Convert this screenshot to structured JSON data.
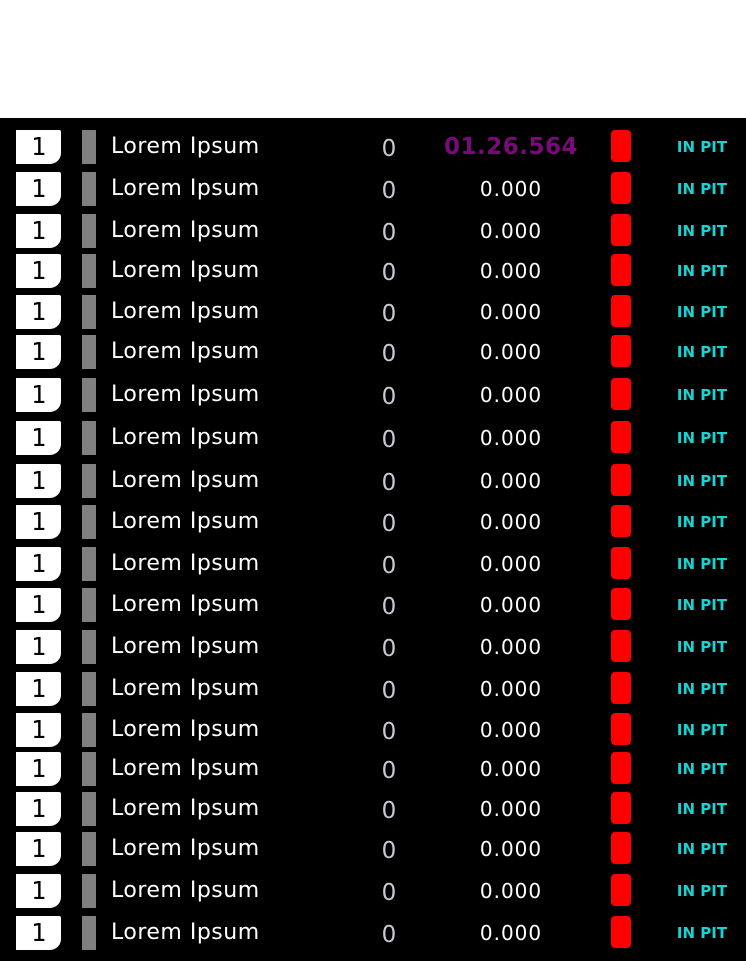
{
  "colors": {
    "page_background": "#ffffff",
    "board_background": "#000000",
    "position_badge": "#ffffff",
    "team_bar": "#808080",
    "driver_text": "#ffffff",
    "laps_text": "#c9c9d6",
    "lap_time_text": "#ffffff",
    "fastest_lap": "#7a0a7a",
    "tyre_light": "#ff0000",
    "status_text": "#19d3d3"
  },
  "leaderboard": {
    "rows": [
      {
        "position": "1",
        "driver": "Lorem Ipsum",
        "laps": "0",
        "lap_time": "01.26.564",
        "fastest": true,
        "status": "IN PIT"
      },
      {
        "position": "1",
        "driver": "Lorem Ipsum",
        "laps": "0",
        "lap_time": "0.000",
        "fastest": false,
        "status": "IN PIT"
      },
      {
        "position": "1",
        "driver": "Lorem Ipsum",
        "laps": "0",
        "lap_time": "0.000",
        "fastest": false,
        "status": "IN PIT"
      },
      {
        "position": "1",
        "driver": "Lorem Ipsum",
        "laps": "0",
        "lap_time": "0.000",
        "fastest": false,
        "status": "IN PIT"
      },
      {
        "position": "1",
        "driver": "Lorem Ipsum",
        "laps": "0",
        "lap_time": "0.000",
        "fastest": false,
        "status": "IN PIT"
      },
      {
        "position": "1",
        "driver": "Lorem Ipsum",
        "laps": "0",
        "lap_time": "0.000",
        "fastest": false,
        "status": "IN PIT"
      },
      {
        "position": "1",
        "driver": "Lorem Ipsum",
        "laps": "0",
        "lap_time": "0.000",
        "fastest": false,
        "status": "IN PIT"
      },
      {
        "position": "1",
        "driver": "Lorem Ipsum",
        "laps": "0",
        "lap_time": "0.000",
        "fastest": false,
        "status": "IN PIT"
      },
      {
        "position": "1",
        "driver": "Lorem Ipsum",
        "laps": "0",
        "lap_time": "0.000",
        "fastest": false,
        "status": "IN PIT"
      },
      {
        "position": "1",
        "driver": "Lorem Ipsum",
        "laps": "0",
        "lap_time": "0.000",
        "fastest": false,
        "status": "IN PIT"
      },
      {
        "position": "1",
        "driver": "Lorem Ipsum",
        "laps": "0",
        "lap_time": "0.000",
        "fastest": false,
        "status": "IN PIT"
      },
      {
        "position": "1",
        "driver": "Lorem Ipsum",
        "laps": "0",
        "lap_time": "0.000",
        "fastest": false,
        "status": "IN PIT"
      },
      {
        "position": "1",
        "driver": "Lorem Ipsum",
        "laps": "0",
        "lap_time": "0.000",
        "fastest": false,
        "status": "IN PIT"
      },
      {
        "position": "1",
        "driver": "Lorem Ipsum",
        "laps": "0",
        "lap_time": "0.000",
        "fastest": false,
        "status": "IN PIT"
      },
      {
        "position": "1",
        "driver": "Lorem Ipsum",
        "laps": "0",
        "lap_time": "0.000",
        "fastest": false,
        "status": "IN PIT"
      },
      {
        "position": "1",
        "driver": "Lorem Ipsum",
        "laps": "0",
        "lap_time": "0.000",
        "fastest": false,
        "status": "IN PIT"
      },
      {
        "position": "1",
        "driver": "Lorem Ipsum",
        "laps": "0",
        "lap_time": "0.000",
        "fastest": false,
        "status": "IN PIT"
      },
      {
        "position": "1",
        "driver": "Lorem Ipsum",
        "laps": "0",
        "lap_time": "0.000",
        "fastest": false,
        "status": "IN PIT"
      },
      {
        "position": "1",
        "driver": "Lorem Ipsum",
        "laps": "0",
        "lap_time": "0.000",
        "fastest": false,
        "status": "IN PIT"
      },
      {
        "position": "1",
        "driver": "Lorem Ipsum",
        "laps": "0",
        "lap_time": "0.000",
        "fastest": false,
        "status": "IN PIT"
      }
    ]
  }
}
